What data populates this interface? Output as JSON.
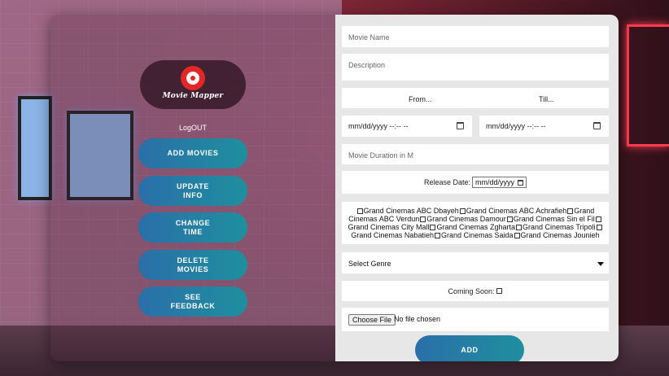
{
  "app": {
    "logo_text": "Movie Mapper",
    "logout_label": "LogOUT"
  },
  "nav": {
    "items": [
      {
        "label": "ADD MOVIES"
      },
      {
        "label": "UPDATE\nINFO"
      },
      {
        "label": "CHANGE\nTIME"
      },
      {
        "label": "DELETE\nMOVIES"
      },
      {
        "label": "SEE\nFEEDBACK"
      }
    ]
  },
  "form": {
    "movie_name_placeholder": "Movie Name",
    "description_placeholder": "Description",
    "from_label": "From...",
    "till_label": "Till...",
    "from_datetime_value": "mm/dd/yyyy --:-- --",
    "till_datetime_value": "mm/dd/yyyy --:-- --",
    "duration_placeholder": "Movie Duration in M",
    "release_date_label": "Release Date:",
    "release_date_value": "mm/dd/yyyy",
    "cinemas": [
      "Grand Cinemas ABC Dbayeh",
      "Grand Cinemas ABC Achrafieh",
      "Grand Cinemas ABC Verdun",
      "Grand Cinemas Damour",
      "Grand Cinemas Sin el Fil",
      "Grand Cinemas City Mall",
      "Grand Cinemas Zgharta",
      "Grand Cinemas Tripoli",
      "Grand Cinemas Nabatieh",
      "Grand Cinemas Saida",
      "Grand Cinemas Jounieh"
    ],
    "genre_selected": "Select Genre",
    "coming_soon_label": "Coming Soon:",
    "file_button_label": "Choose File",
    "file_status": "No file chosen",
    "submit_label": "ADD"
  },
  "colors": {
    "button_gradient_start": "#2a6fa8",
    "button_gradient_end": "#1f8f9e",
    "logo_red": "#e32626",
    "form_bg": "#e7e7e7"
  }
}
